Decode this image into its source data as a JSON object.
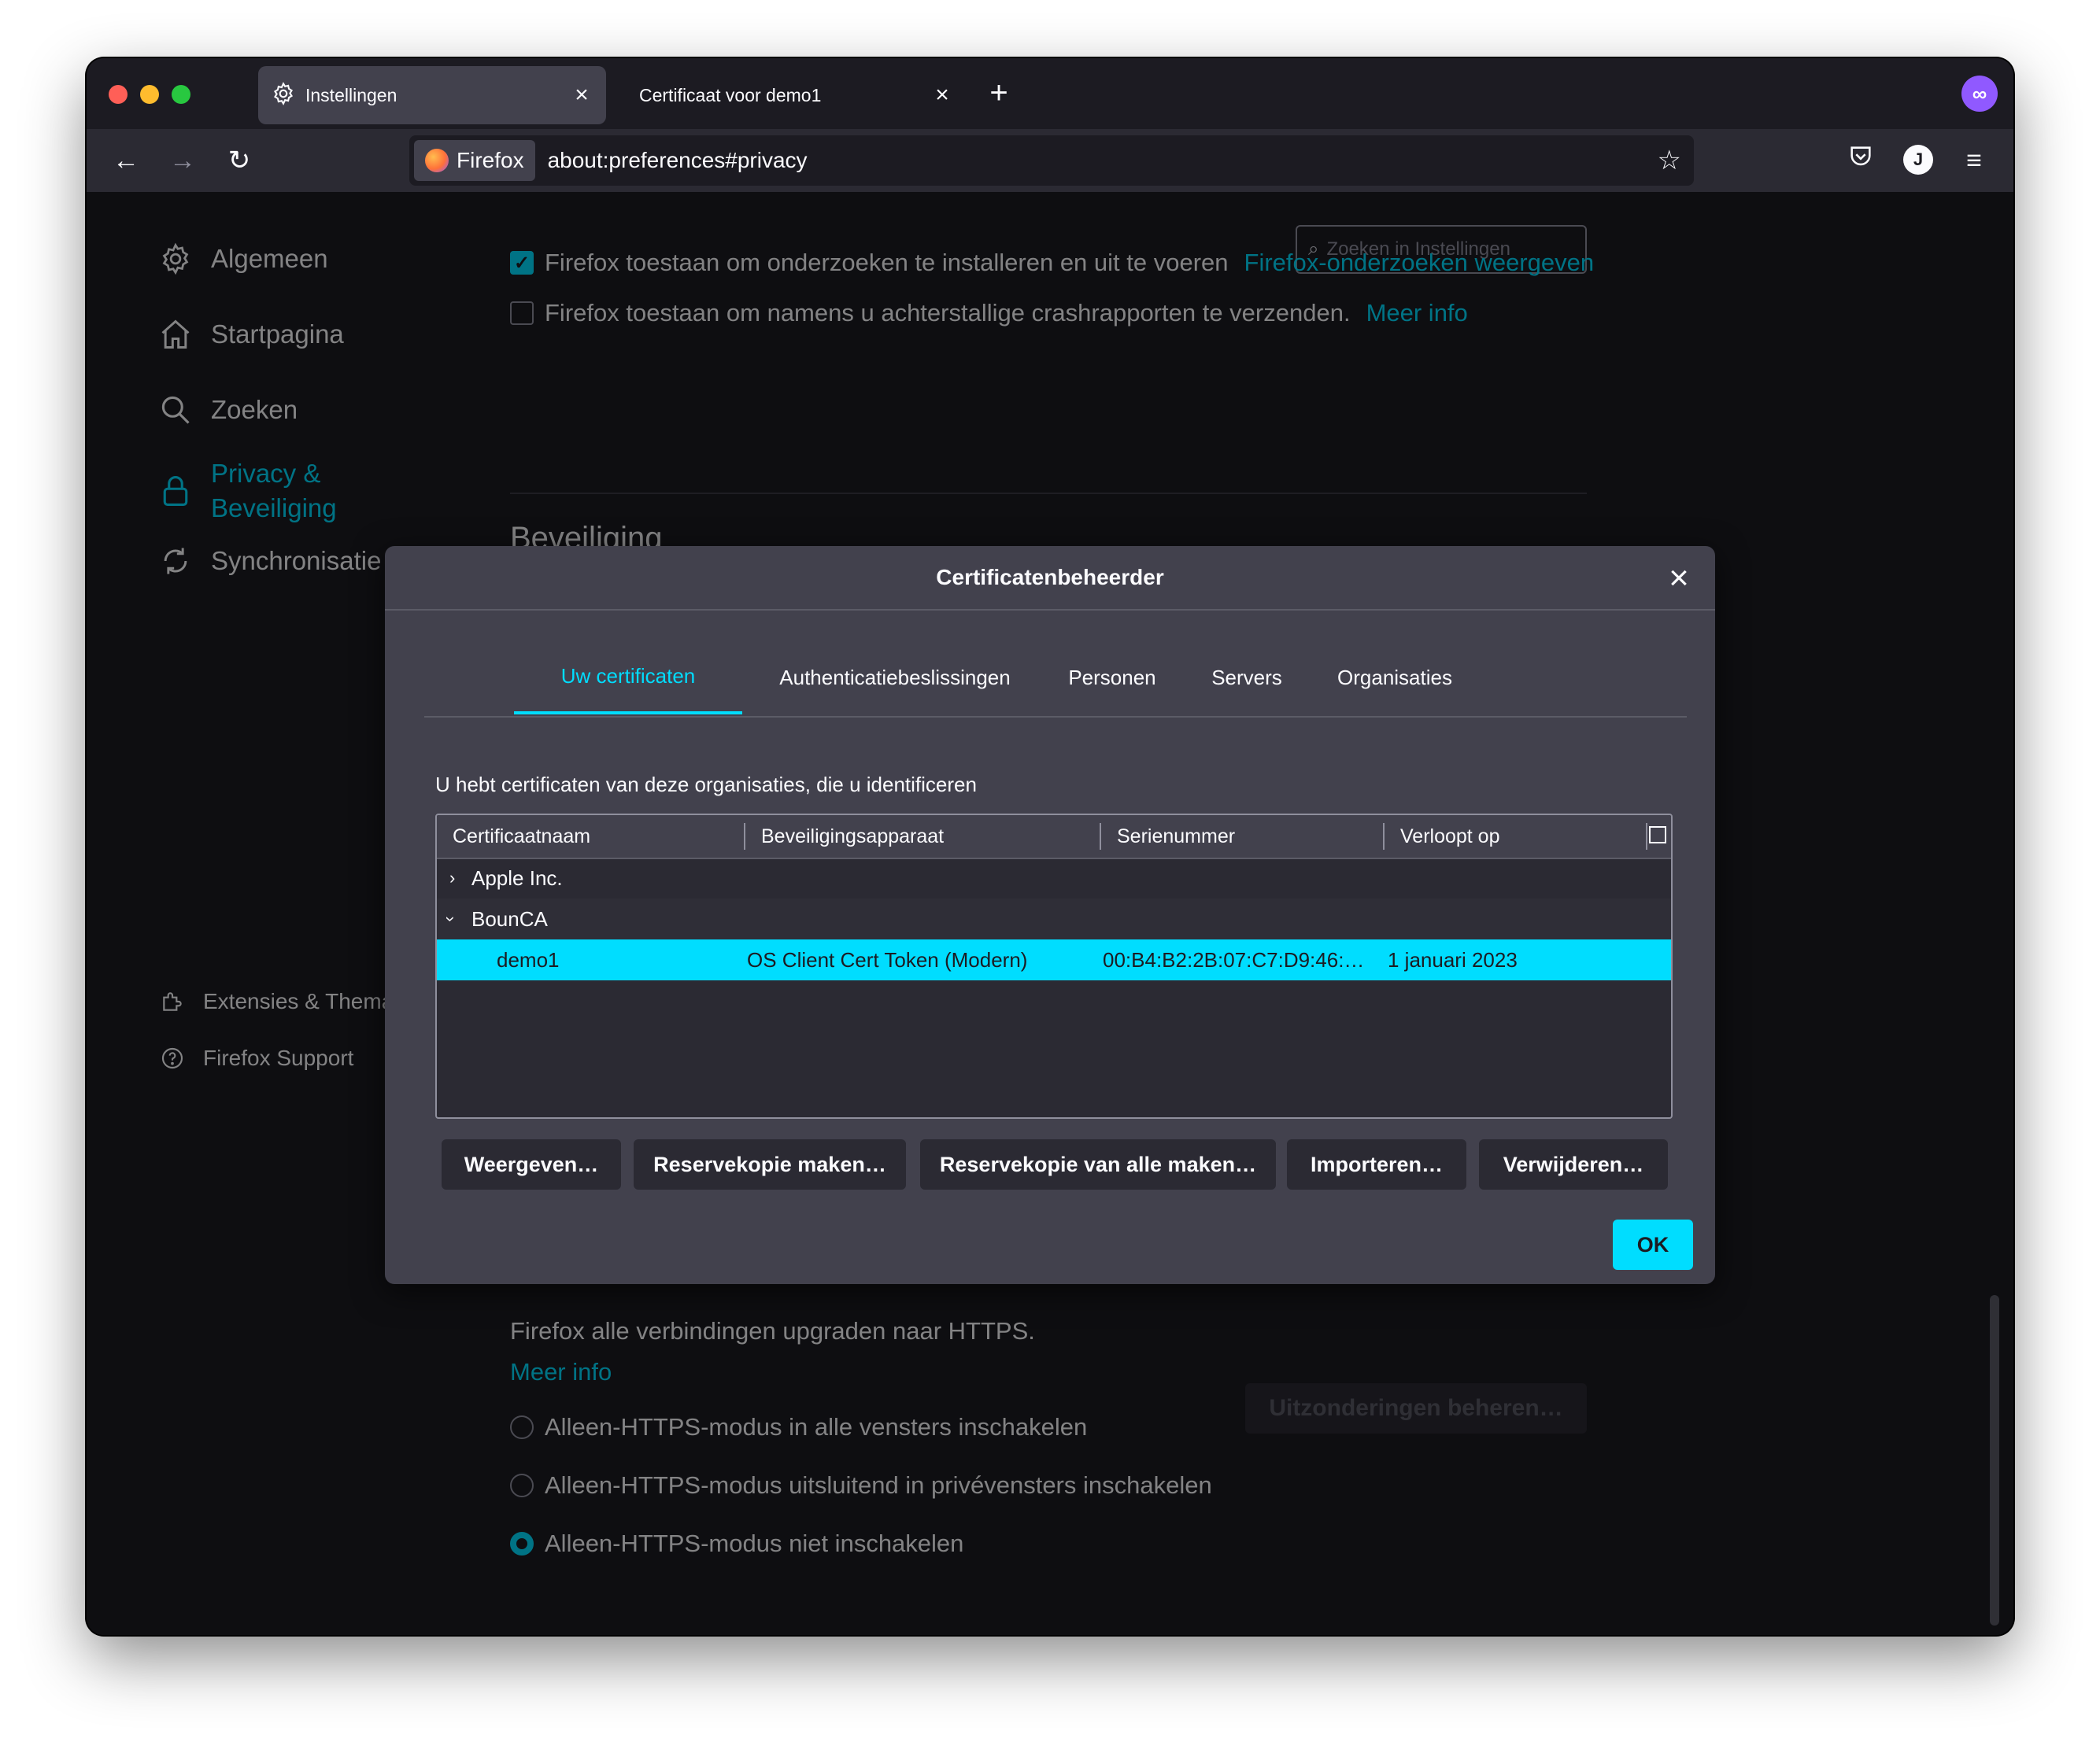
{
  "tabs": [
    {
      "label": "Instellingen",
      "icon": "gear-icon"
    },
    {
      "label": "Certificaat voor demo1"
    }
  ],
  "navbar": {
    "identity_label": "Firefox",
    "url": "about:preferences#privacy"
  },
  "avatar_initial": "J",
  "search": {
    "placeholder": "Zoeken in Instellingen"
  },
  "sidebar": {
    "items": [
      {
        "label": "Algemeen",
        "icon": "gear-icon"
      },
      {
        "label": "Startpagina",
        "icon": "home-icon"
      },
      {
        "label": "Zoeken",
        "icon": "search-icon"
      },
      {
        "label_line1": "Privacy &",
        "label_line2": "Beveiliging",
        "icon": "lock-icon",
        "selected": true
      },
      {
        "label": "Synchronisatie",
        "icon": "sync-icon"
      }
    ],
    "footer": [
      {
        "label": "Extensies & Thema’s",
        "icon": "puzzle-icon"
      },
      {
        "label": "Firefox Support",
        "icon": "help-icon"
      }
    ]
  },
  "prefs": {
    "studies_label": "Firefox toestaan om onderzoeken te installeren en uit te voeren",
    "studies_link": "Firefox-onderzoeken weergeven",
    "studies_checked": true,
    "crash_label": "Firefox toestaan om namens u achterstallige crashrapporten te verzenden.",
    "crash_link": "Meer info",
    "crash_checked": false,
    "section_heading": "Beveiliging",
    "https_text": "Firefox alle verbindingen upgraden naar HTTPS.",
    "https_more": "Meer info",
    "https_options": [
      {
        "label": "Alleen-HTTPS-modus in alle vensters inschakelen",
        "selected": false
      },
      {
        "label": "Alleen-HTTPS-modus uitsluitend in privévensters inschakelen",
        "selected": false
      },
      {
        "label": "Alleen-HTTPS-modus niet inschakelen",
        "selected": true
      }
    ],
    "exceptions_button": "Uitzonderingen beheren…"
  },
  "dialog": {
    "title": "Certificatenbeheerder",
    "tabs": [
      "Uw certificaten",
      "Authenticatiebeslissingen",
      "Personen",
      "Servers",
      "Organisaties"
    ],
    "selected_tab": 0,
    "description": "U hebt certificaten van deze organisaties, die u identificeren",
    "columns": [
      "Certificaatnaam",
      "Beveiligingsapparaat",
      "Serienummer",
      "Verloopt op"
    ],
    "rows": [
      {
        "name": "Apple Inc.",
        "type": "group",
        "expanded": false
      },
      {
        "name": "BounCA",
        "type": "group",
        "expanded": true
      },
      {
        "name": "demo1",
        "device": "OS Client Cert Token (Modern)",
        "serial": "00:B4:B2:2B:07:C7:D9:46:…",
        "expires": "1 januari 2023",
        "selected": true
      }
    ],
    "buttons": [
      "Weergeven…",
      "Reservekopie maken…",
      "Reservekopie van alle maken…",
      "Importeren…",
      "Verwijderen…"
    ],
    "ok": "OK"
  },
  "colors": {
    "accent": "#00ddff",
    "background": "#1c1b22",
    "dialog": "#42414d",
    "toolbar": "#2b2a33"
  }
}
